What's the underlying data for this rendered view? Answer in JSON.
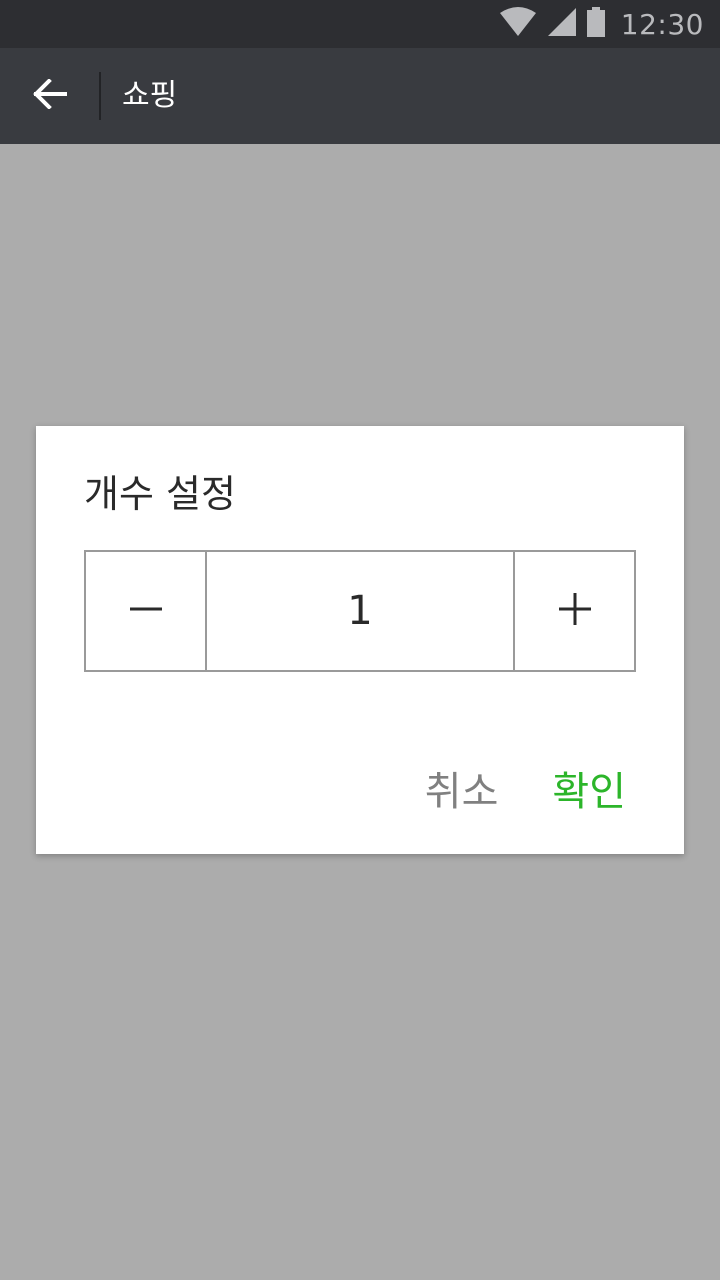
{
  "status_bar": {
    "time": "12:30",
    "icons": [
      "wifi-icon",
      "signal-icon",
      "battery-icon"
    ]
  },
  "app_bar": {
    "title": "쇼핑",
    "back_icon": "arrow-left-icon"
  },
  "dialog": {
    "title": "개수 설정",
    "quantity": "1",
    "decrement_icon": "minus-icon",
    "increment_icon": "plus-icon",
    "cancel_label": "취소",
    "confirm_label": "확인"
  },
  "colors": {
    "status_bar": "#2d2e32",
    "app_bar": "#393b40",
    "scrim": "#acacac",
    "accent": "#2cb52a",
    "cancel": "#808080"
  }
}
